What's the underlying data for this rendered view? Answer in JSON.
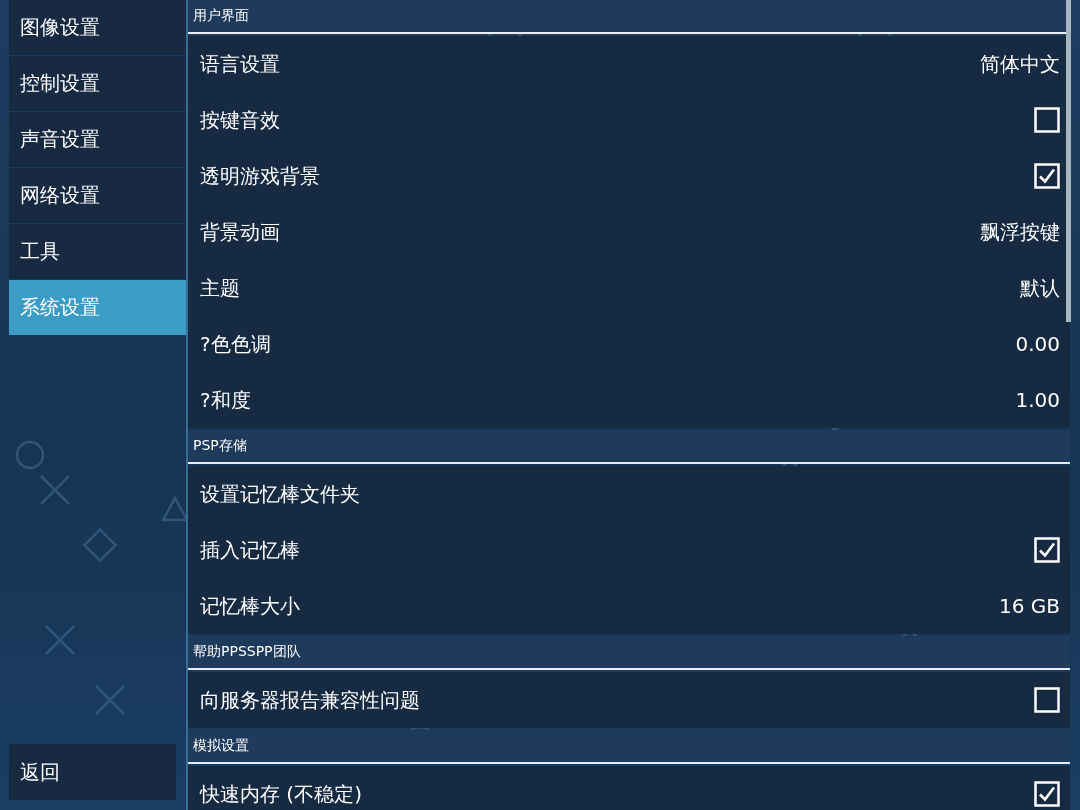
{
  "sidebar": {
    "items": [
      {
        "label": "图像设置",
        "selected": false
      },
      {
        "label": "控制设置",
        "selected": false
      },
      {
        "label": "声音设置",
        "selected": false
      },
      {
        "label": "网络设置",
        "selected": false
      },
      {
        "label": "工具",
        "selected": false
      },
      {
        "label": "系统设置",
        "selected": true
      }
    ],
    "back_button": "返回"
  },
  "sections": [
    {
      "title": "用户界面",
      "rows": [
        {
          "kind": "value",
          "label": "语言设置",
          "value": "简体中文"
        },
        {
          "kind": "checkbox",
          "label": "按键音效",
          "checked": false
        },
        {
          "kind": "checkbox",
          "label": "透明游戏背景",
          "checked": true
        },
        {
          "kind": "value",
          "label": "背景动画",
          "value": "飘浮按键"
        },
        {
          "kind": "value",
          "label": "主题",
          "value": "默认"
        },
        {
          "kind": "value",
          "label": "?色色调",
          "value": "0.00"
        },
        {
          "kind": "value",
          "label": "?和度",
          "value": "1.00"
        }
      ]
    },
    {
      "title": "PSP存储",
      "rows": [
        {
          "kind": "plain",
          "label": "设置记忆棒文件夹"
        },
        {
          "kind": "checkbox",
          "label": "插入记忆棒",
          "checked": true
        },
        {
          "kind": "value",
          "label": "记忆棒大小",
          "value": "16 GB"
        }
      ]
    },
    {
      "title": "帮助PPSSPP团队",
      "rows": [
        {
          "kind": "checkbox",
          "label": "向服务器报告兼容性问题",
          "checked": false
        }
      ]
    },
    {
      "title": "模拟设置",
      "rows": [
        {
          "kind": "checkbox",
          "label": "快速内存 (不稳定)",
          "checked": true
        }
      ]
    }
  ]
}
